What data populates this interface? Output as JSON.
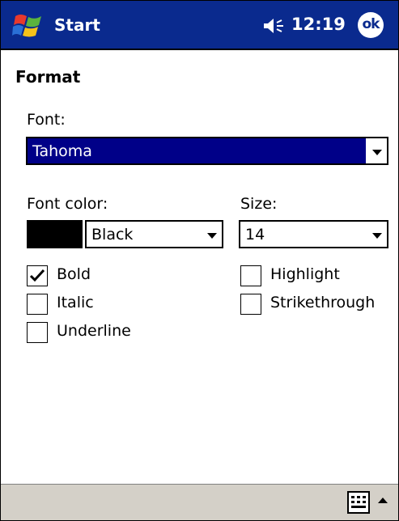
{
  "titlebar": {
    "app_title": "Start",
    "time": "12:19",
    "ok_label": "ok",
    "color": "#0a2a8e"
  },
  "format": {
    "heading": "Format",
    "font_label": "Font:",
    "font_value": "Tahoma",
    "font_color_label": "Font color:",
    "font_color_value": "Black",
    "font_color_swatch": "#000000",
    "size_label": "Size:",
    "size_value": "14"
  },
  "options": {
    "bold": {
      "label": "Bold",
      "checked": true
    },
    "italic": {
      "label": "Italic",
      "checked": false
    },
    "underline": {
      "label": "Underline",
      "checked": false
    },
    "highlight": {
      "label": "Highlight",
      "checked": false
    },
    "strikethrough": {
      "label": "Strikethrough",
      "checked": false
    }
  },
  "bottombar": {
    "keyboard_icon": "keyboard-icon",
    "sip_arrow_icon": "up-arrow-icon"
  }
}
